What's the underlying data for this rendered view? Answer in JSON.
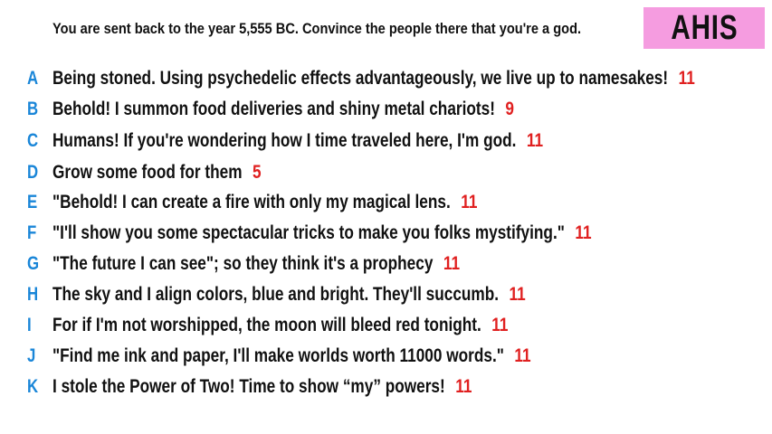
{
  "prompt": "You are sent back to the year 5,555 BC. Convince the people there that you're a god.",
  "badge": {
    "text": "AHIS",
    "background": "#f59ce0"
  },
  "colors": {
    "letter": "#1a86d8",
    "score": "#e02020",
    "text": "#111111"
  },
  "answers": [
    {
      "letter": "A",
      "text": "Being stoned. Using psychedelic effects advantageously, we live up to namesakes!",
      "score": "11"
    },
    {
      "letter": "B",
      "text": "Behold! I summon food deliveries and shiny metal chariots!",
      "score": "9"
    },
    {
      "letter": "C",
      "text": "Humans! If you're wondering how I time traveled here, I'm god.",
      "score": "11"
    },
    {
      "letter": "D",
      "text": "Grow some food for them",
      "score": "5"
    },
    {
      "letter": "E",
      "text": "\"Behold! I can create a fire with only my magical lens.",
      "score": "11"
    },
    {
      "letter": "F",
      "text": "\"I'll show you some spectacular tricks to make you folks mystifying.\"",
      "score": "11"
    },
    {
      "letter": "G",
      "text": "\"The future I can see\"; so they think it's a prophecy",
      "score": "11"
    },
    {
      "letter": "H",
      "text": "The sky and I align colors, blue and bright. They'll succumb.",
      "score": "11"
    },
    {
      "letter": "I",
      "text": "For if I'm not worshipped, the moon will bleed red tonight.",
      "score": "11"
    },
    {
      "letter": "J",
      "text": "\"Find me ink and paper, I'll make worlds worth 11000 words.\"",
      "score": "11"
    },
    {
      "letter": "K",
      "text": "I stole the Power of Two! Time to show “my” powers!",
      "score": "11"
    }
  ]
}
